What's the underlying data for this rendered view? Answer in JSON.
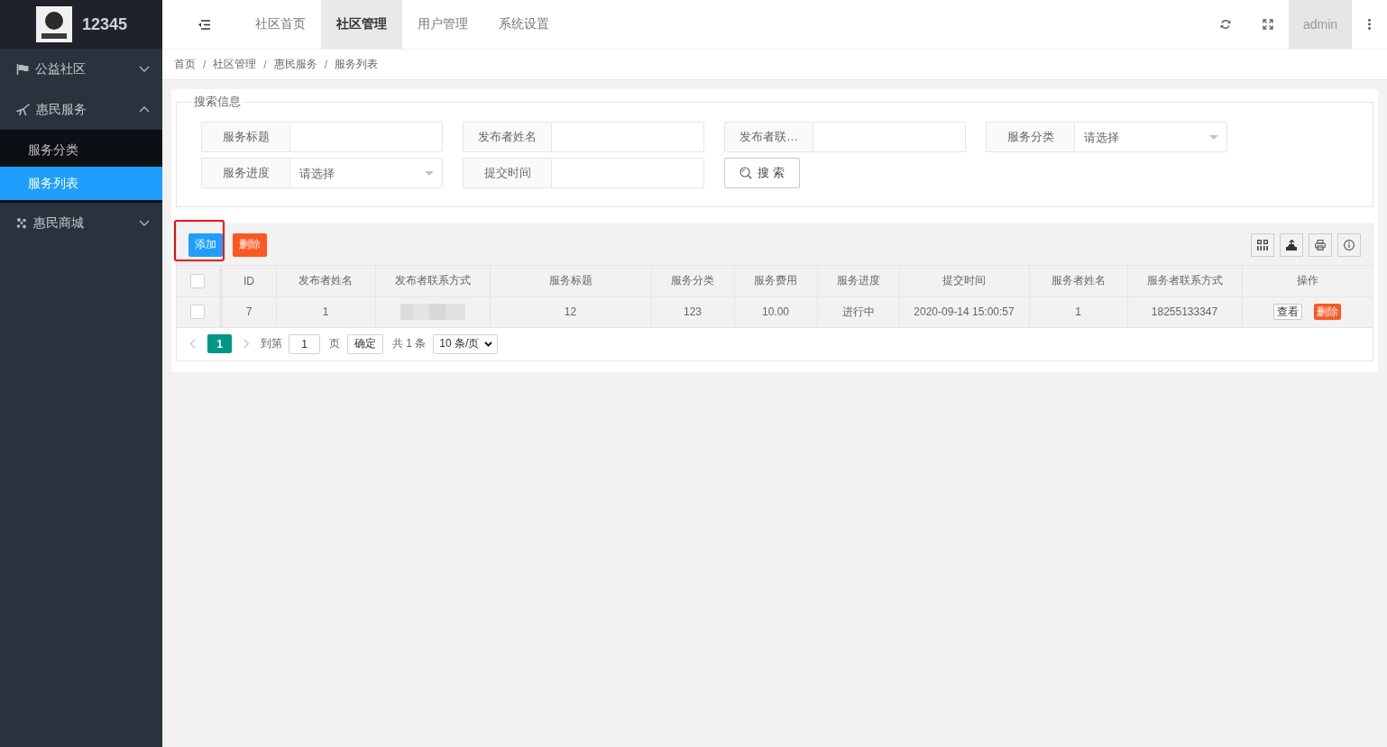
{
  "sidebar": {
    "logo_text": "12345",
    "menu": [
      {
        "label": "公益社区",
        "expanded": false
      },
      {
        "label": "惠民服务",
        "expanded": true,
        "children": [
          {
            "label": "服务分类",
            "selected": false
          },
          {
            "label": "服务列表",
            "selected": true
          }
        ]
      },
      {
        "label": "惠民商城",
        "expanded": false
      }
    ]
  },
  "header": {
    "tabs": [
      {
        "label": "社区首页",
        "selected": false
      },
      {
        "label": "社区管理",
        "selected": true
      },
      {
        "label": "用户管理",
        "selected": false
      },
      {
        "label": "系统设置",
        "selected": false
      }
    ],
    "user": "admin"
  },
  "breadcrumb": [
    {
      "label": "首页"
    },
    {
      "separator": "/",
      "label": "社区管理"
    },
    {
      "separator": "/",
      "label": "惠民服务"
    },
    {
      "separator": "/",
      "label": "服务列表"
    }
  ],
  "search": {
    "legend": "搜索信息",
    "fields": [
      {
        "kind": "input",
        "label": "服务标题"
      },
      {
        "kind": "input",
        "label": "发布者姓名"
      },
      {
        "kind": "input",
        "label": "发布者联…"
      },
      {
        "kind": "select",
        "label": "服务分类",
        "placeholder": "请选择"
      },
      {
        "kind": "select",
        "label": "服务进度",
        "placeholder": "请选择"
      },
      {
        "kind": "input",
        "label": "提交时间"
      }
    ],
    "button": "搜 索"
  },
  "toolbar": {
    "buttons": [
      {
        "kind": "primary",
        "label": "添加",
        "highlighted": true
      },
      {
        "kind": "danger",
        "label": "删除",
        "highlighted": false
      }
    ]
  },
  "table": {
    "header_checked": false,
    "columns": [
      "ID",
      "发布者姓名",
      "发布者联系方式",
      "服务标题",
      "服务分类",
      "服务费用",
      "服务进度",
      "提交时间",
      "服务者姓名",
      "服务者联系方式",
      "操作"
    ],
    "rows": [
      {
        "checked": false,
        "cells": [
          "7",
          "1",
          {
            "kind": "blurred"
          },
          "12",
          "123",
          "10.00",
          "进行中",
          "2020-09-14 15:00:57",
          "1",
          "18255133347"
        ],
        "actions": [
          {
            "kind": "default",
            "label": "查看"
          },
          {
            "kind": "danger",
            "label": "删除"
          }
        ]
      }
    ]
  },
  "pagination": {
    "pages": [
      {
        "label": "1",
        "selected": true
      }
    ],
    "goto_label": "到第",
    "goto_value": "1",
    "page_unit": "页",
    "confirm": "确定",
    "total": "共 1 条",
    "page_size": "10 条/页"
  }
}
